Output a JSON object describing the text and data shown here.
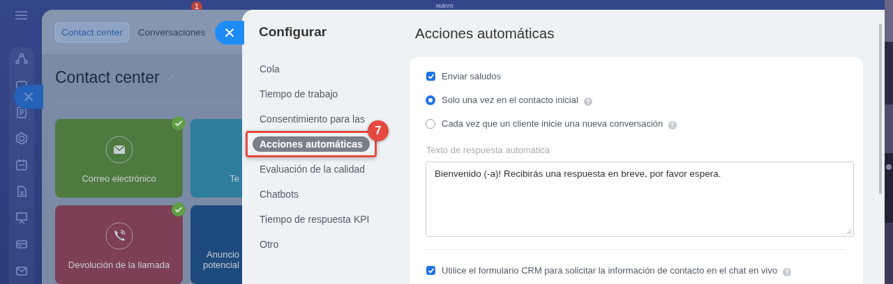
{
  "topbar": {
    "notification_badge": "1",
    "new_label": "NUEVO"
  },
  "back_panel": {
    "tabs": [
      {
        "label": "Contact center",
        "selected": true
      },
      {
        "label": "Conversaciones",
        "selected": false
      }
    ],
    "title": "Contact center",
    "cards": [
      {
        "label": "Correo electrónico",
        "color": "#4e7a40",
        "connected": true
      },
      {
        "label": "Te",
        "color": "#2e7d9e",
        "connected": false
      },
      {
        "label": "Devolución de la llamada",
        "color": "#7c3f55",
        "connected": true
      },
      {
        "label": "Anuncio\npotencial",
        "color": "#1f4a7d",
        "connected": false
      }
    ]
  },
  "config": {
    "title": "Configurar",
    "nav": [
      {
        "label": "Cola",
        "selected": false
      },
      {
        "label": "Tiempo de trabajo",
        "selected": false
      },
      {
        "label": "Consentimiento para las",
        "selected": false
      },
      {
        "label": "Acciones automáticas",
        "selected": true
      },
      {
        "label": "Evaluación de la calidad",
        "selected": false
      },
      {
        "label": "Chatbots",
        "selected": false
      },
      {
        "label": "Tiempo de respuesta KPI",
        "selected": false
      },
      {
        "label": "Otro",
        "selected": false
      }
    ],
    "annotation": {
      "number": "7"
    },
    "content": {
      "title": "Acciones automáticas",
      "options": [
        {
          "kind": "checkbox",
          "label": "Enviar saludos",
          "checked": true,
          "help": false
        },
        {
          "kind": "radio",
          "label": "Solo una vez en el contacto inicial",
          "selected": true,
          "help": true
        },
        {
          "kind": "radio",
          "label": "Cada vez que un cliente inicie una nueva conversación",
          "selected": false,
          "help": true
        },
        {
          "kind": "textarea",
          "label": "Texto de respuesta automática",
          "value": "Bienvenido (-a)! Recibirás una respuesta en breve, por favor espera."
        },
        {
          "kind": "divider"
        },
        {
          "kind": "checkbox",
          "label": "Utilice el formulario CRM para solicitar la información de contacto en el chat en vivo",
          "checked": true,
          "help": true
        }
      ]
    }
  }
}
